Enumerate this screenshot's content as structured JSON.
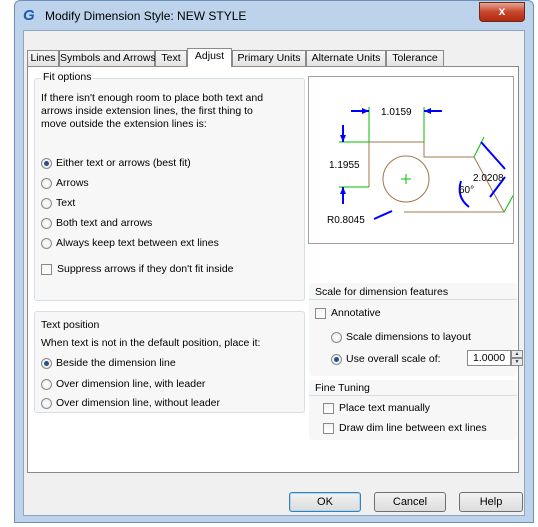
{
  "window": {
    "title": "Modify Dimension Style: NEW STYLE",
    "close_label": "x"
  },
  "tabs": [
    "Lines",
    "Symbols and Arrows",
    "Text",
    "Adjust",
    "Primary Units",
    "Alternate Units",
    "Tolerance"
  ],
  "fit_options": {
    "label": "Fit options",
    "description_lines": [
      "If there isn't enough room to place both text and",
      "arrows inside extension lines, the first thing to",
      "move outside the extension lines is:"
    ],
    "options": [
      "Either text or arrows (best fit)",
      "Arrows",
      "Text",
      "Both text and arrows",
      "Always keep text between ext lines"
    ],
    "selected": "Either text or arrows (best fit)",
    "suppress_label": "Suppress arrows if they don't fit inside"
  },
  "text_position": {
    "label": "Text position",
    "description": "When text is not in the default position, place it:",
    "options": [
      "Beside the dimension line",
      "Over dimension line, with leader",
      "Over dimension line, without leader"
    ],
    "selected": "Beside the dimension line"
  },
  "preview": {
    "dims": [
      "1.0159",
      "1.1955",
      "2.0208",
      "60°",
      "R0.8045"
    ]
  },
  "scale": {
    "label": "Scale for dimension features",
    "annotative_label": "Annotative",
    "option_layout": "Scale dimensions to layout",
    "option_overall": "Use overall scale of:",
    "selected": "Use overall scale of:",
    "overall_value": "1.0000"
  },
  "fine_tuning": {
    "label": "Fine Tuning",
    "place_manually": "Place text manually",
    "draw_dim_line": "Draw dim line between ext lines"
  },
  "buttons": {
    "ok": "OK",
    "cancel": "Cancel",
    "help": "Help"
  },
  "colors": {
    "accent": "#2a4f8f",
    "preview_dim": "#0000ff",
    "preview_ext": "#00c000",
    "preview_geom": "#a0784a"
  }
}
